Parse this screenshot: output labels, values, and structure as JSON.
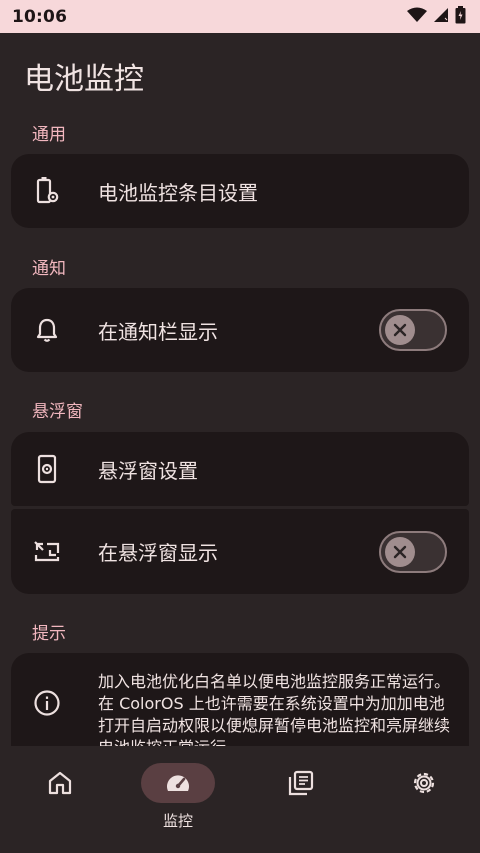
{
  "status_bar": {
    "time": "10:06",
    "icons": [
      "wifi-icon",
      "signal-icon",
      "battery-icon"
    ]
  },
  "page": {
    "title": "电池监控"
  },
  "sections": {
    "general": {
      "title": "通用",
      "items": [
        {
          "label": "电池监控条目设置",
          "icon": "battery-settings-icon"
        }
      ]
    },
    "notification": {
      "title": "通知",
      "items": [
        {
          "label": "在通知栏显示",
          "icon": "bell-icon",
          "toggle": false
        }
      ]
    },
    "floating": {
      "title": "悬浮窗",
      "items": [
        {
          "label": "悬浮窗设置",
          "icon": "phone-settings-icon"
        },
        {
          "label": "在悬浮窗显示",
          "icon": "picture-in-picture-icon",
          "toggle": false
        }
      ]
    },
    "tips": {
      "title": "提示",
      "text": "加入电池优化白名单以便电池监控服务正常运行。在 ColorOS 上也许需要在系统设置中为加加电池打开自启动权限以便熄屏暂停电池监控和亮屏继续电池监控正常运行。",
      "icon": "info-icon"
    }
  },
  "bottom_nav": {
    "items": [
      {
        "label": "",
        "icon": "home-icon"
      },
      {
        "label": "监控",
        "icon": "speedometer-icon",
        "active": true
      },
      {
        "label": "",
        "icon": "library-icon"
      },
      {
        "label": "",
        "icon": "gear-icon"
      }
    ]
  },
  "colors": {
    "background": "#2b2425",
    "card": "#1e1718",
    "accent": "#f2b7bf",
    "status_bar": "#f7d8da",
    "active_nav_pill": "#5a3f42"
  }
}
